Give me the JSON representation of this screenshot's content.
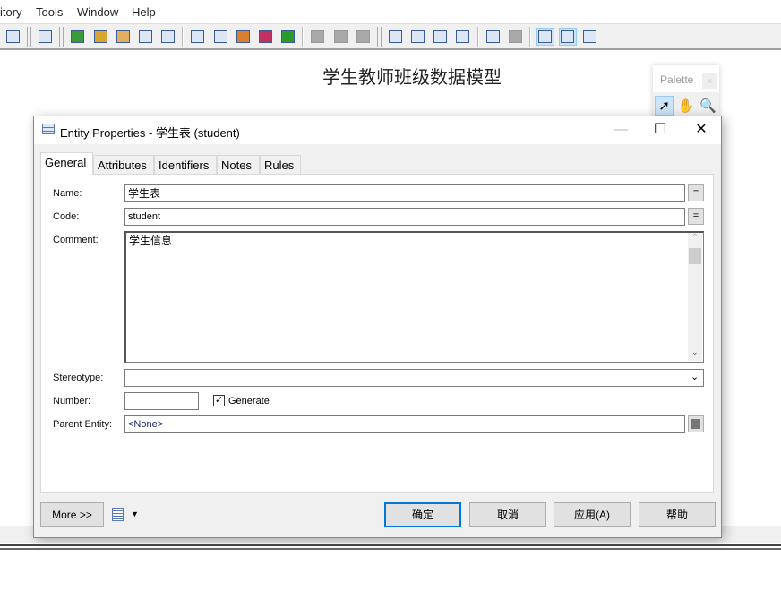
{
  "menu": [
    "itory",
    "Tools",
    "Window",
    "Help"
  ],
  "toolbar": {
    "icons": [
      "properties-icon",
      "grip",
      "help-book-icon",
      "grip",
      "new-model-icon",
      "paste-shortcut-icon",
      "find-objects-icon",
      "refresh-icon",
      "check-model-icon",
      "sep",
      "shadow-icon",
      "text-format-icon",
      "pen-icon",
      "fill-color-icon",
      "font-icon",
      "sep",
      "align-icon-disabled",
      "back-arrow-icon-disabled",
      "forward-arrow-icon-disabled",
      "grip",
      "diagram-view-1-icon",
      "diagram-view-2-icon",
      "page-icon",
      "two-pages-icon",
      "sep",
      "reverse-engineer-icon",
      "disabled-icon",
      "sep",
      "preview-icon",
      "comment-view-icon",
      "list-view-icon"
    ]
  },
  "model_title": "学生教师班级数据模型",
  "palette": {
    "title": "Palette",
    "close": "x"
  },
  "dialog": {
    "title": "Entity Properties - 学生表 (student)",
    "tabs": [
      "General",
      "Attributes",
      "Identifiers",
      "Notes",
      "Rules"
    ],
    "active_tab": "General",
    "fields": {
      "name_label": "Name:",
      "name_value": "学生表",
      "code_label": "Code:",
      "code_value": "student",
      "comment_label": "Comment:",
      "comment_value": "学生信息",
      "stereotype_label": "Stereotype:",
      "stereotype_value": "",
      "number_label": "Number:",
      "number_value": "",
      "generate_label": "Generate",
      "generate_checked": true,
      "parent_label": "Parent Entity:",
      "parent_value": "<None>",
      "eq_label": "="
    },
    "buttons": {
      "more": "More >>",
      "ok": "确定",
      "cancel": "取消",
      "apply": "应用(A)",
      "help": "帮助"
    }
  },
  "colors": {
    "accent": "#0078d7",
    "selected_tool": "#cce4f7"
  }
}
